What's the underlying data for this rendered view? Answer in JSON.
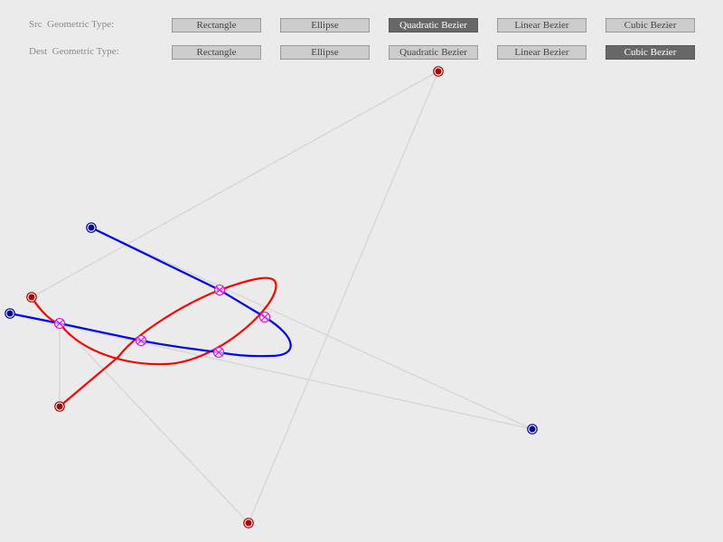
{
  "src_row": {
    "label": "Src  Geometric Type:",
    "options": [
      "Rectangle",
      "Ellipse",
      "Quadratic Bezier",
      "Linear Bezier",
      "Cubic Bezier"
    ],
    "selected": "Quadratic Bezier"
  },
  "dest_row": {
    "label": "Dest  Geometric Type:",
    "options": [
      "Rectangle",
      "Ellipse",
      "Quadratic Bezier",
      "Linear Bezier",
      "Cubic Bezier"
    ],
    "selected": "Cubic Bezier"
  },
  "colors": {
    "background": "#ebebeb",
    "src_curve": "#ff0000",
    "dest_curve": "#0000ff",
    "control_line": "#d9d9d9",
    "src_control_point": "#aa0000",
    "dest_control_point": "#000099",
    "intersection": "#ee00ee"
  },
  "intersection_count": 5
}
